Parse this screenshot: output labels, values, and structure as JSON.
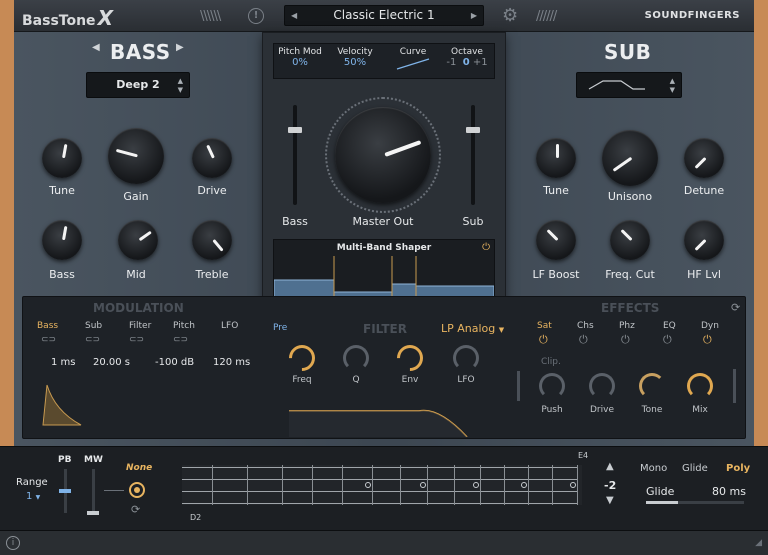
{
  "app": {
    "name": "BassTone",
    "name_suffix": "X",
    "brand": "SOUNDFINGERS",
    "preset": "Classic Electric 1"
  },
  "bass": {
    "title": "BASS",
    "preset": "Deep 2",
    "knobs": [
      {
        "label": "Tune"
      },
      {
        "label": "Gain"
      },
      {
        "label": "Drive"
      },
      {
        "label": "Bass"
      },
      {
        "label": "Mid"
      },
      {
        "label": "Treble"
      }
    ]
  },
  "sub": {
    "title": "SUB",
    "knobs": [
      {
        "label": "Tune"
      },
      {
        "label": "Unisono"
      },
      {
        "label": "Detune"
      },
      {
        "label": "LF Boost"
      },
      {
        "label": "Freq. Cut"
      },
      {
        "label": "HF Lvl"
      }
    ]
  },
  "center": {
    "pitch_mod_label": "Pitch Mod",
    "pitch_mod_value": "0%",
    "velocity_label": "Velocity",
    "velocity_value": "50%",
    "curve_label": "Curve",
    "octave_label": "Octave",
    "octave_minus": "-1",
    "octave_value": "0",
    "octave_plus": "+1",
    "bass_fader": "Bass",
    "master_label": "Master Out",
    "sub_fader": "Sub",
    "shaper_title": "Multi-Band Shaper"
  },
  "modulation": {
    "title": "MODULATION",
    "tabs": [
      "Bass",
      "Sub",
      "Filter",
      "Pitch",
      "LFO"
    ],
    "values": [
      "1 ms",
      "20.00 s",
      "-100 dB",
      "120 ms"
    ]
  },
  "filter": {
    "title": "FILTER",
    "pre": "Pre",
    "type": "LP Analog",
    "knobs": [
      "Freq",
      "Q",
      "Env",
      "LFO"
    ]
  },
  "effects": {
    "title": "EFFECTS",
    "tabs": [
      "Sat",
      "Chs",
      "Phz",
      "EQ",
      "Dyn"
    ],
    "clip": "Clip.",
    "knobs": [
      "Push",
      "Drive",
      "Tone",
      "Mix"
    ]
  },
  "performance": {
    "range_label": "Range",
    "range_value": "1",
    "pb": "PB",
    "mw": "MW",
    "mw_target": "None",
    "note_low": "D2",
    "note_high": "E4",
    "transpose": "-2",
    "modes": [
      "Mono",
      "Glide",
      "Poly"
    ],
    "glide_label": "Glide",
    "glide_value": "80 ms"
  }
}
